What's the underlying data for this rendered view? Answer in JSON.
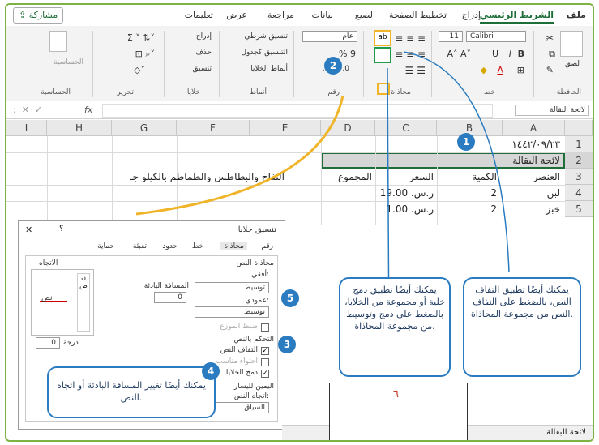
{
  "ribbon": {
    "tabs": [
      "ملف",
      "الشريط الرئيسي",
      "إدراج",
      "تخطيط الصفحة",
      "الصيغ",
      "بيانات",
      "مراجعة",
      "عرض",
      "تعليمات"
    ],
    "share_label": "مشاركة",
    "groups": {
      "clipboard": "الحافظة",
      "font": "خط",
      "alignment": "محاذاة",
      "number": "رقم",
      "styles": "أنماط",
      "cells": "خلايا",
      "editing": "تحرير",
      "analysis": "الحساسية"
    },
    "paste_label": "لصق",
    "font_name": "Calibri",
    "font_size": "11",
    "number_format": "عام",
    "percent_symbol": "% 9",
    "styles_items": [
      "تنسيق شرطي",
      "التنسيق كجدول",
      "أنماط الخلايا"
    ],
    "cells_items": [
      "إدراج",
      "حذف",
      "تنسيق"
    ],
    "analysis_label": "الحساسية"
  },
  "formula_bar": {
    "name_box": "لائحة البقالة",
    "fx": "fx"
  },
  "sheet": {
    "columns": [
      "A",
      "B",
      "C",
      "D",
      "E",
      "F",
      "G",
      "H",
      "I"
    ],
    "rows": [
      "1",
      "2",
      "3",
      "4",
      "5"
    ],
    "cells": {
      "a1": "١٤٤٢/٠٩/٢٣",
      "a2": "لائحة البقالة",
      "a3": "العنصر",
      "b3": "الكمية",
      "c3": "السعر",
      "d3": "المجموع",
      "f3": "التفاح والبطاطس والطماطم بالكيلو جـ",
      "a4": "لبن",
      "b4": "2",
      "c4": "ر.س. 19.00",
      "a5": "خبز",
      "b5": "2",
      "c5": "ر.س. 1.00"
    },
    "sheet_tab": "لائحة البقالة"
  },
  "dialog": {
    "title": "تنسيق خلايا",
    "help": "؟",
    "close": "✕",
    "tabs": [
      "رقم",
      "محاذاة",
      "خط",
      "حدود",
      "تعبئة",
      "حماية"
    ],
    "text_alignment": "محاذاة النص",
    "horizontal_label": "أفقي:",
    "horizontal_value": "توسيط",
    "indent_label": "المسافة البادئة:",
    "indent_value": "0",
    "vertical_label": "عمودي:",
    "vertical_value": "توسيط",
    "justify_distributed": "ضبط الموزع",
    "text_control": "التحكم بالنص",
    "wrap_text": "التفاف النص",
    "shrink_to_fit": "احتواء مناسب",
    "merge_cells": "دمج الخلايا",
    "rtl": "اليمين لليسار",
    "text_direction_label": "اتجاه النص:",
    "text_direction_value": "السياق",
    "orientation": "الاتجاه",
    "orientation_text": "نص",
    "degrees_value": "0",
    "degrees_label": "درجة"
  },
  "callouts": {
    "c1": "يمكنك أيضًا تطبيق التفاف النص، بالضغط على التفاف النص من مجموعة المحاذاة.",
    "c2": "يمكنك أيضًا تطبيق دمج خلية أو مجموعة من الخلايا، بالضغط على دمج وتوسيط من مجموعة المحاذاة.",
    "c3": "يمكنك أيضًا تغيير المسافة البادئة أو اتجاه النص."
  },
  "badges": [
    "1",
    "2",
    "3",
    "4",
    "5"
  ],
  "page_number": "٦",
  "colors": {
    "accent": "#2a7bbf",
    "highlight": "#f0b429",
    "excel_green": "#1e6e3a",
    "frame": "#7cb342",
    "selected_row": "#d6d6d6"
  }
}
